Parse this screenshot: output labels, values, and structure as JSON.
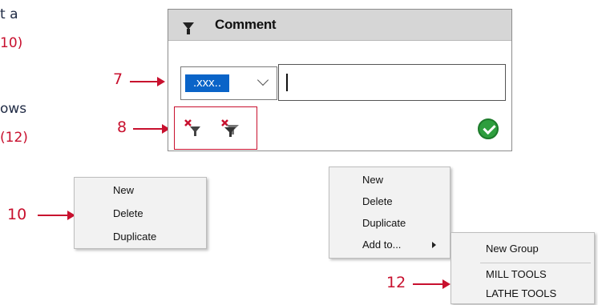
{
  "left_text": {
    "line1": "t a",
    "line2": "10)",
    "line3": "ows",
    "line4": "(12)"
  },
  "callouts": {
    "c7": "7",
    "c8": "8",
    "c10": "10",
    "c12": "12"
  },
  "comment_panel": {
    "title": "Comment",
    "combo_value": ".xxx..",
    "input_value": "",
    "filter_icons": [
      "clear-filter-icon",
      "clear-all-filters-icon"
    ],
    "apply_icon": "green-checkmark-icon"
  },
  "menu_a": {
    "items": [
      "New",
      "Delete",
      "Duplicate"
    ]
  },
  "menu_b": {
    "items": [
      "New",
      "Delete",
      "Duplicate",
      "Add to..."
    ]
  },
  "submenu": {
    "items": [
      "New Group",
      "MILL TOOLS",
      "LATHE TOOLS"
    ]
  },
  "colors": {
    "callout_red": "#c8102e",
    "text_dark": "#1f2a44",
    "selection_blue": "#0a64c8",
    "ok_green": "#2e9e3e"
  }
}
